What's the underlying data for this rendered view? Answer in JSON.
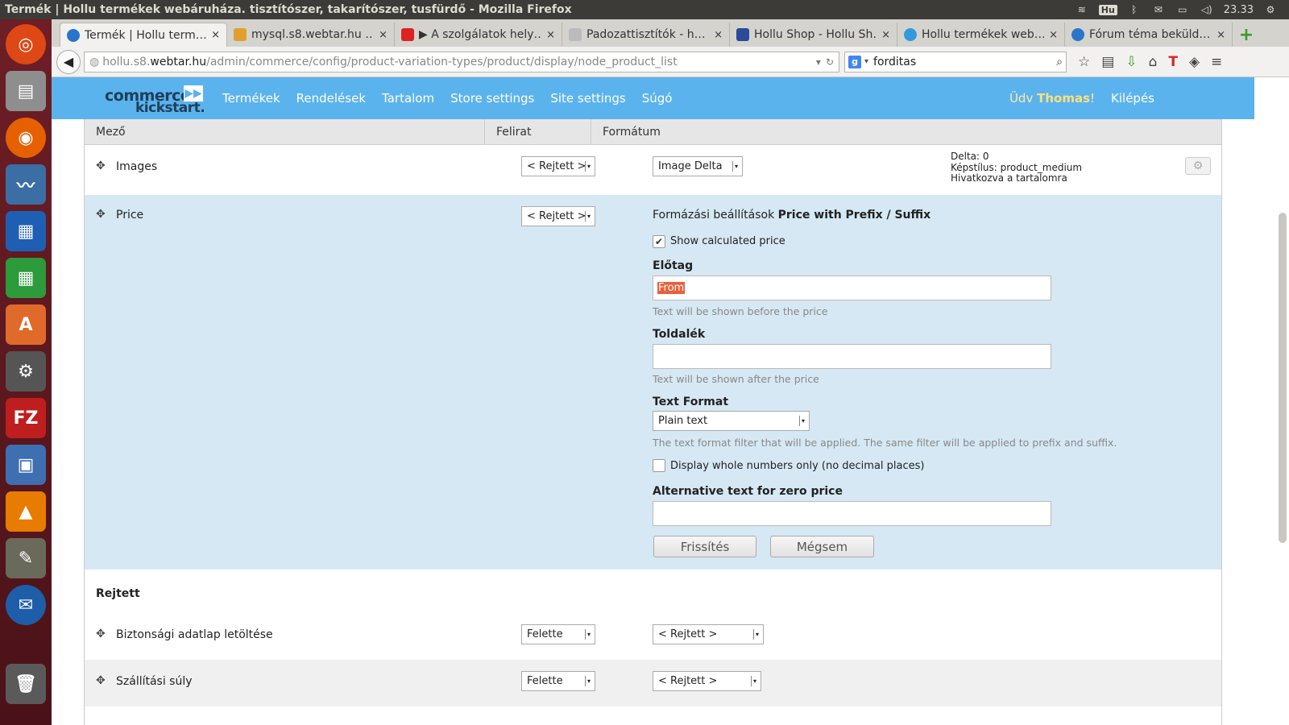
{
  "window": {
    "title": "Termék | Hollu termékek webáruháza. tisztítószer, takarítószer, tusfürdő - Mozilla Firefox"
  },
  "tray": {
    "keyboard": "Hu",
    "clock": "23.33"
  },
  "tabs": [
    {
      "label": "Termék | Hollu term…",
      "color": "#2a75c9"
    },
    {
      "label": "mysql.s8.webtar.hu …",
      "color": "#e0a030"
    },
    {
      "label": "▶ A szolgálatok hely…",
      "color": "#d22"
    },
    {
      "label": "Padozattisztítók - h…",
      "color": "#bbb"
    },
    {
      "label": "Hollu Shop - Hollu Sh…",
      "color": "#2b4a9a"
    },
    {
      "label": "Hollu termékek web…",
      "color": "#3399dd"
    },
    {
      "label": "Fórum téma beküld…",
      "color": "#2a75c9"
    }
  ],
  "tab_close": "×",
  "new_tab": "+",
  "url": {
    "domain_pre": "hollu.s8.",
    "domain": "webtar.hu",
    "path": "/admin/commerce/config/product-variation-types/product/display/node_product_list"
  },
  "search": {
    "engine": "g",
    "value": "forditas"
  },
  "site": {
    "logo_top": "commerce",
    "logo_bottom": "kickstart.",
    "logo_badge": "▶▶",
    "menu": [
      "Termékek",
      "Rendelések",
      "Tartalom",
      "Store settings",
      "Site settings",
      "Súgó"
    ],
    "greeting": "Üdv ",
    "user": "Thomas",
    "greeting_end": "!",
    "logout": "Kilépés"
  },
  "table": {
    "headers": [
      "Mező",
      "Felirat",
      "Formátum"
    ],
    "images_row": {
      "name": "Images",
      "label": "< Rejtett >",
      "format": "Image Delta",
      "info": [
        "Delta: 0",
        "Képstílus: product_medium",
        "Hivatkozva a tartalomra"
      ]
    },
    "price_row": {
      "name": "Price",
      "label": "< Rejtett >",
      "heading_pre": "Formázási beállítások ",
      "heading_bold": "Price with Prefix / Suffix",
      "show_calc": "Show calculated price",
      "prefix_label": "Előtag",
      "prefix_value": "From",
      "prefix_desc": "Text will be shown before the price",
      "suffix_label": "Toldalék",
      "suffix_desc": "Text will be shown after the price",
      "format_label": "Text Format",
      "format_value": "Plain text",
      "format_desc": "The text format filter that will be applied. The same filter will be applied to prefix and suffix.",
      "whole_numbers": "Display whole numbers only (no decimal places)",
      "zero_label": "Alternative text for zero price",
      "update_btn": "Frissítés",
      "cancel_btn": "Mégsem"
    },
    "hidden_section": "Rejtett",
    "hidden_rows": [
      {
        "name": "Biztonsági adatlap letöltése",
        "label": "Felette",
        "format": "< Rejtett >"
      },
      {
        "name": "Szállítási súly",
        "label": "Felette",
        "format": "< Rejtett >"
      }
    ]
  }
}
